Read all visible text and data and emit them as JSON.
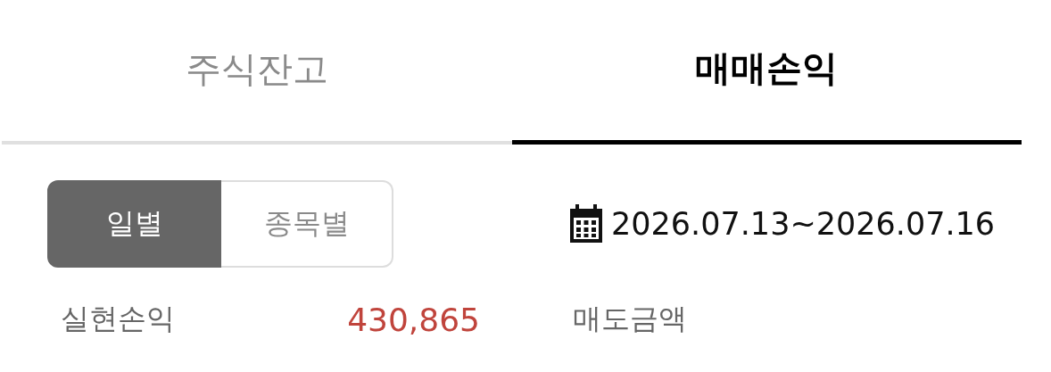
{
  "tabs": [
    {
      "label": "주식잔고",
      "selected": false
    },
    {
      "label": "매매손익",
      "selected": true
    }
  ],
  "view_toggle": [
    {
      "label": "일별",
      "selected": true
    },
    {
      "label": "종목별",
      "selected": false
    }
  ],
  "date_range": "2026.07.13~2026.07.16",
  "summary": [
    {
      "label": "실현손익",
      "value": "430,865"
    },
    {
      "label": "매도금액"
    }
  ]
}
